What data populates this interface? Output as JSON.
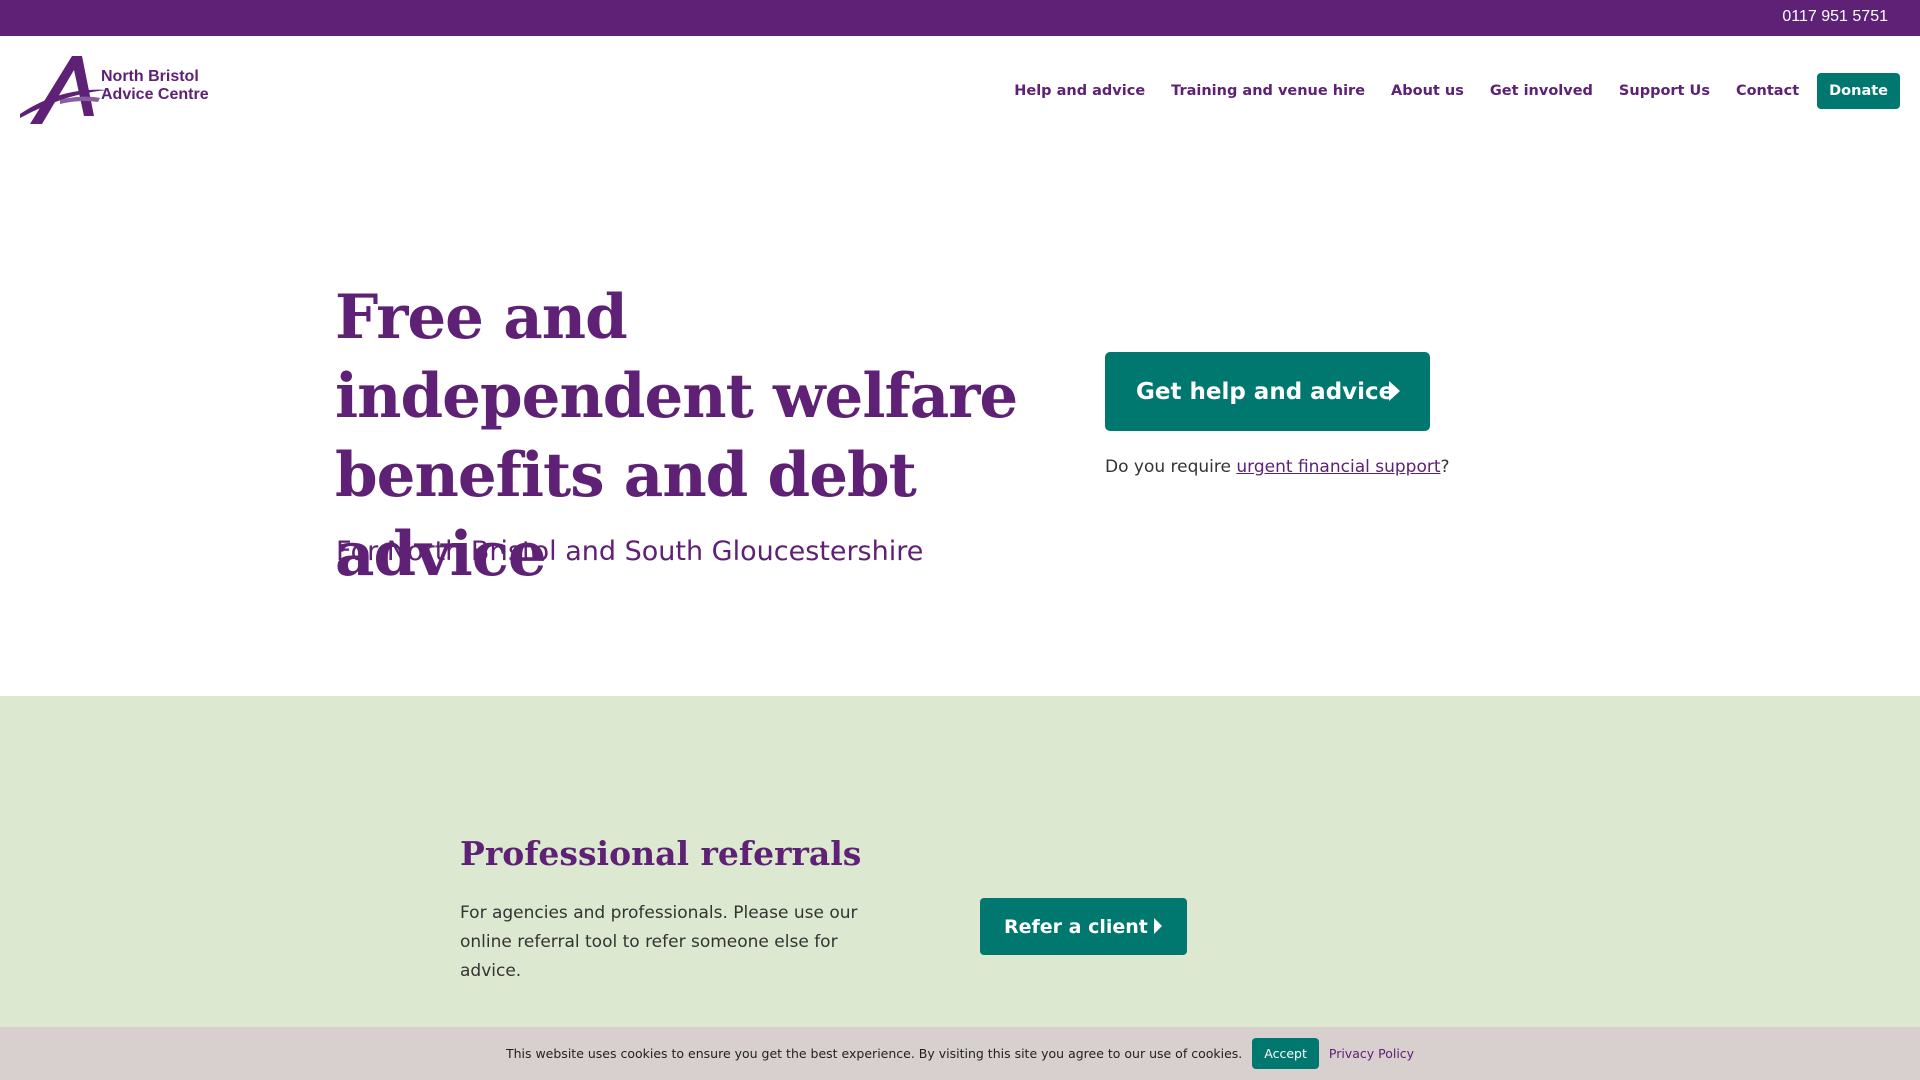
{
  "topbar": {
    "phone": "0117 951 5751"
  },
  "logo": {
    "line1": "North Bristol",
    "line2": "Advice Centre"
  },
  "nav": {
    "items": [
      "Help and advice",
      "Training and venue hire",
      "About us",
      "Get involved",
      "Support Us",
      "Contact"
    ],
    "donate": "Donate"
  },
  "hero": {
    "title": "Free and independent welfare benefits and debt advice",
    "subtitle": "For North Bristol and South Gloucestershire",
    "cta": "Get help and advice",
    "urgent_prefix": "Do you require ",
    "urgent_link": "urgent financial support",
    "urgent_suffix": "?"
  },
  "referrals": {
    "title": "Professional referrals",
    "text": "For agencies and professionals. Please use our online referral tool to refer someone else for advice.",
    "button": "Refer a client"
  },
  "cookie": {
    "message": "This website uses cookies to ensure you get the best experience. By visiting this site you agree to our use of cookies.",
    "accept": "Accept",
    "privacy": "Privacy Policy"
  },
  "colors": {
    "brand_purple": "#5e2175",
    "accent_teal": "#00786f",
    "section_green": "#dce9d0",
    "cookie_bar": "#d8cfcf"
  },
  "icons": [
    "logo-a-mark",
    "arrow-right-icon"
  ]
}
